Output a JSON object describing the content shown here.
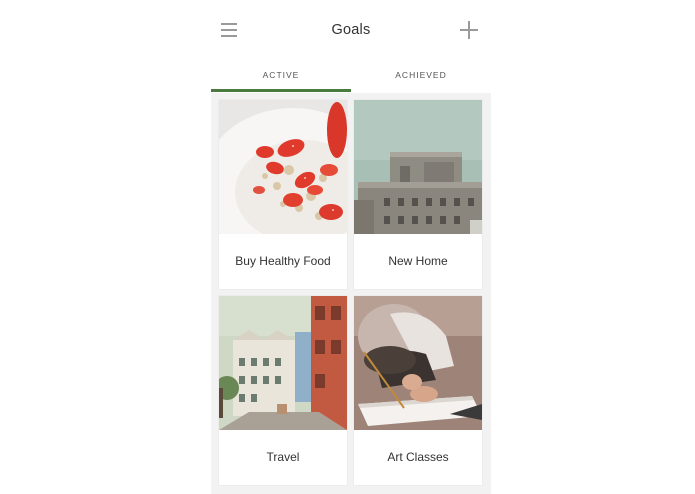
{
  "header": {
    "title": "Goals",
    "menu_icon": "hamburger-menu-icon",
    "add_icon": "plus-icon"
  },
  "tabs": [
    {
      "label": "ACTIVE",
      "active": true
    },
    {
      "label": "ACHIEVED",
      "active": false
    }
  ],
  "goals": [
    {
      "label": "Buy Healthy Food",
      "image": "strawberries-granola-bowl"
    },
    {
      "label": "New Home",
      "image": "concrete-building-sky"
    },
    {
      "label": "Travel",
      "image": "colorful-street-houses"
    },
    {
      "label": "Art Classes",
      "image": "hand-writing-notebook"
    }
  ],
  "colors": {
    "accent": "#4b7a3f",
    "grid_background": "#f2f2f2",
    "text": "#333333"
  }
}
